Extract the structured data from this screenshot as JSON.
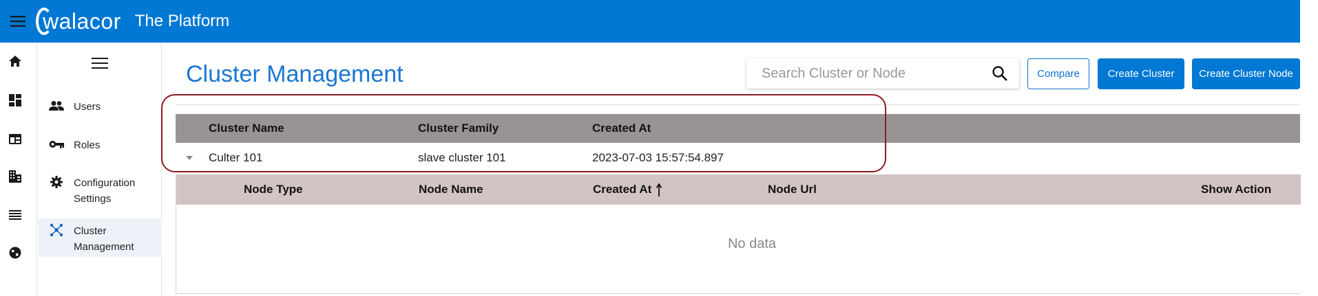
{
  "header": {
    "logo_text": "walacor",
    "title": "The Platform",
    "bg_color": "#0078d4"
  },
  "rail": {
    "items": [
      {
        "icon": "home-icon"
      },
      {
        "icon": "dashboard-icon"
      },
      {
        "icon": "web-icon"
      },
      {
        "icon": "business-icon"
      },
      {
        "icon": "list-icon"
      },
      {
        "icon": "globe-icon"
      }
    ]
  },
  "sidebar": {
    "items": [
      {
        "label": "Users",
        "icon": "users-icon"
      },
      {
        "label": "Roles",
        "icon": "key-icon"
      },
      {
        "label": "Configuration Settings",
        "icon": "gear-icon"
      },
      {
        "label": "Cluster Management",
        "icon": "cluster-icon",
        "active": true
      }
    ]
  },
  "main": {
    "title": "Cluster Management",
    "search_placeholder": "Search Cluster or Node",
    "buttons": {
      "compare": "Compare",
      "create_cluster": "Create Cluster",
      "create_cluster_node": "Create Cluster Node"
    },
    "cluster_table": {
      "columns": [
        "Cluster Name",
        "Cluster Family",
        "Created At"
      ],
      "rows": [
        {
          "name": "Culter 101",
          "family": "slave cluster 101",
          "created_at": "2023-07-03 15:57:54.897"
        }
      ]
    },
    "node_table": {
      "columns": [
        "Node Type",
        "Node Name",
        "Created At",
        "Node Url",
        "Show Action"
      ],
      "empty_text": "No data"
    }
  },
  "colors": {
    "accent": "#0078d4",
    "title_blue": "#1976d2",
    "header_gray": "#999494",
    "subheader_rose": "#d3c4c4",
    "highlight_border": "#8b1a22"
  }
}
